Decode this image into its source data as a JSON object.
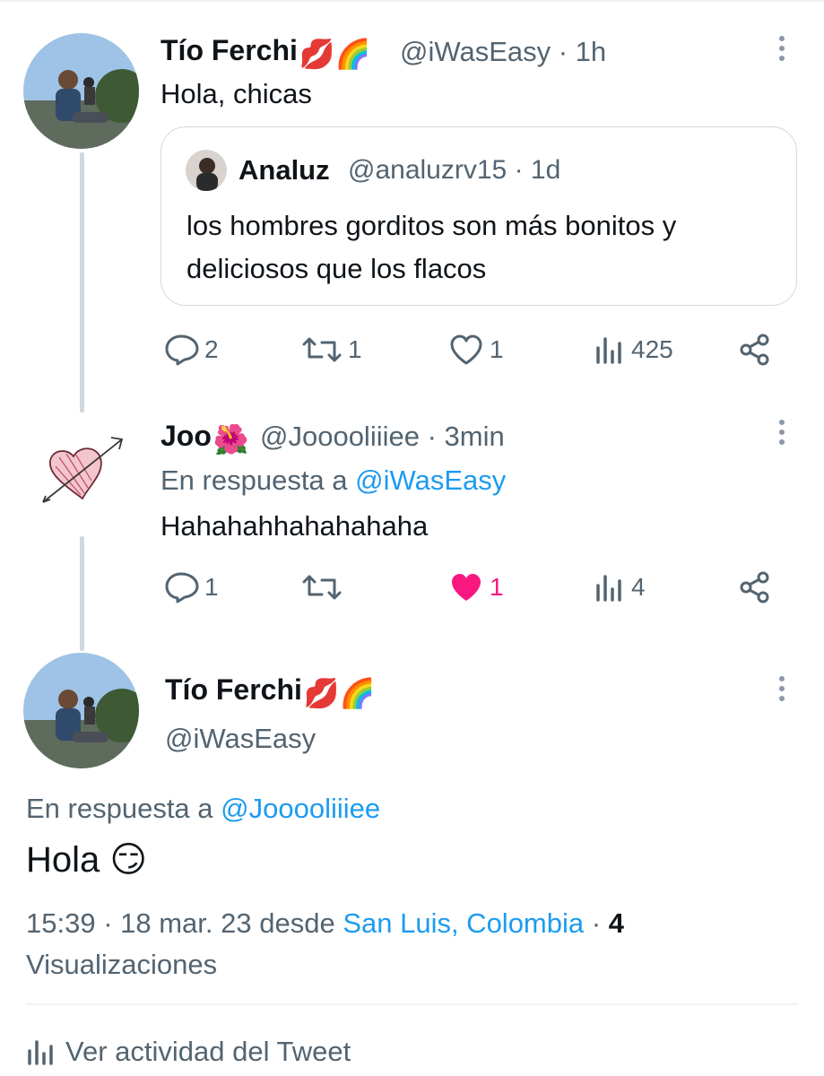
{
  "tweet1": {
    "name": "Tío Ferchi",
    "name_emojis": "💋🌈",
    "handle": "@iWasEasy",
    "time": "· 1h",
    "text": "Hola, chicas",
    "quote": {
      "name": "Analuz",
      "handle": "@analuzrv15",
      "time": "· 1d",
      "text": "los hombres gorditos son más bonitos y deliciosos que los flacos"
    },
    "actions": {
      "replies": "2",
      "retweets": "1",
      "likes": "1",
      "views": "425"
    }
  },
  "tweet2": {
    "name": "Joo",
    "name_emojis": "🌺",
    "handle": "@Jooooliiiee",
    "time": "· 3min",
    "reply_prefix": "En respuesta a",
    "reply_to": "@iWasEasy",
    "text": "Hahahahhahahahaha",
    "actions": {
      "replies": "1",
      "retweets": "",
      "likes": "1",
      "views": "4"
    },
    "liked": true
  },
  "main_tweet": {
    "name": "Tío Ferchi",
    "name_emojis": "💋🌈",
    "handle": "@iWasEasy",
    "reply_prefix": "En respuesta a",
    "reply_to": "@Jooooliiiee",
    "text": "Hola",
    "text_emoji": "😏",
    "time": "15:39 · 18 mar. 23 desde",
    "location": "San Luis, Colombia",
    "views_sep": "·",
    "views_count": "4",
    "views_label": "Visualizaciones",
    "activity_label": "Ver actividad del Tweet"
  },
  "colors": {
    "accent": "#1d9bf0",
    "like": "#f91880",
    "muted": "#536471"
  }
}
